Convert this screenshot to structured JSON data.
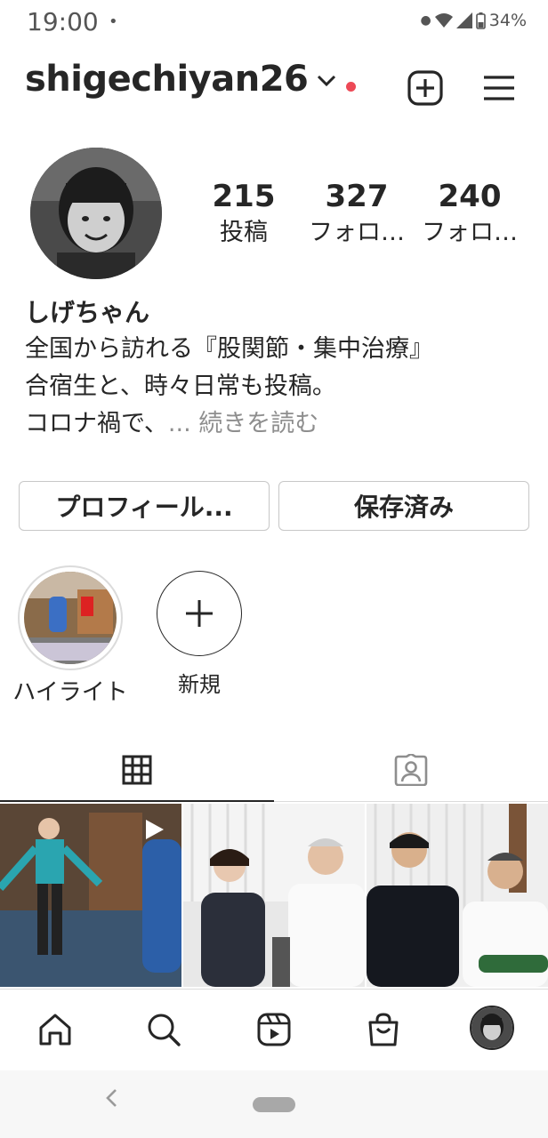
{
  "status_bar": {
    "time": "19:00",
    "dot": "•",
    "battery": "34%",
    "icons": [
      "notification-dot-icon",
      "wifi-icon",
      "signal-icon",
      "battery-icon"
    ]
  },
  "header": {
    "username": "shigechiyan26",
    "icons": [
      "chevron-down-icon",
      "new-post-icon",
      "menu-icon"
    ],
    "notification_color": "#ed4956"
  },
  "stats": [
    {
      "number": "215",
      "label": "投稿"
    },
    {
      "number": "327",
      "label": "フォロ…"
    },
    {
      "number": "240",
      "label": "フォロ…"
    }
  ],
  "bio": {
    "display_name": "しげちゃん",
    "lines": [
      "全国から訪れる『股関節・集中治療』",
      "合宿生と、時々日常も投稿。",
      "コロナ禍で、"
    ],
    "more": "... 続きを読む"
  },
  "buttons": {
    "edit_profile": "プロフィール...",
    "saved": "保存済み"
  },
  "highlights": [
    {
      "label": "ハイライト"
    },
    {
      "label": "新規"
    }
  ],
  "tabs": [
    "grid-icon",
    "tagged-icon"
  ],
  "bottom_nav": [
    "home-icon",
    "search-icon",
    "reels-icon",
    "shop-icon",
    "profile-avatar"
  ]
}
